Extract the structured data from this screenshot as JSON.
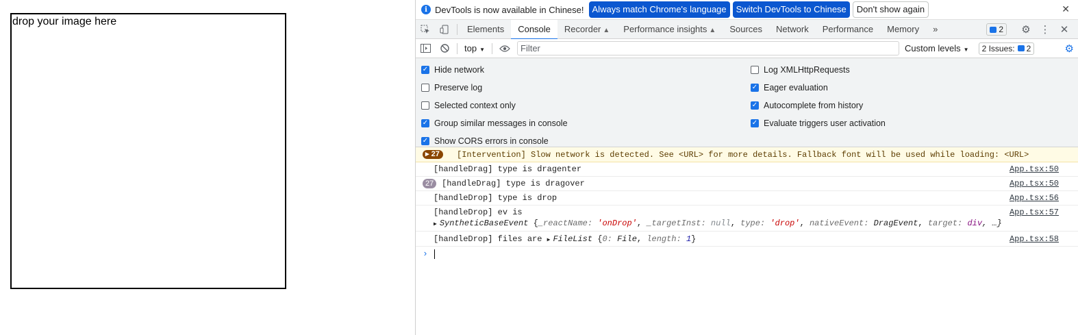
{
  "page": {
    "dropzone_text": "drop your image here"
  },
  "infobar": {
    "message": "DevTools is now available in Chinese!",
    "btn_match": "Always match Chrome's language",
    "btn_switch": "Switch DevTools to Chinese",
    "btn_dismiss": "Don't show again",
    "close": "✕"
  },
  "tabs": [
    "Elements",
    "Console",
    "Recorder",
    "Performance insights",
    "Sources",
    "Network",
    "Performance",
    "Memory"
  ],
  "tabbar": {
    "overflow": "»",
    "messages_count": "2"
  },
  "toolbar": {
    "context": "top",
    "filter_placeholder": "Filter",
    "levels": "Custom levels",
    "issues_label": "2 Issues:",
    "issues_count": "2"
  },
  "settings": {
    "left": [
      {
        "label": "Hide network",
        "checked": true
      },
      {
        "label": "Preserve log",
        "checked": false
      },
      {
        "label": "Selected context only",
        "checked": false
      },
      {
        "label": "Group similar messages in console",
        "checked": true
      },
      {
        "label": "Show CORS errors in console",
        "checked": true
      }
    ],
    "right": [
      {
        "label": "Log XMLHttpRequests",
        "checked": false
      },
      {
        "label": "Eager evaluation",
        "checked": true
      },
      {
        "label": "Autocomplete from history",
        "checked": true
      },
      {
        "label": "Evaluate triggers user activation",
        "checked": true
      }
    ]
  },
  "console": {
    "warning": {
      "count": "27",
      "text": "[Intervention] Slow network is detected. See <URL> for more details. Fallback font will be used while loading: <URL>"
    },
    "rows": [
      {
        "text": "[handleDrag] type is dragenter",
        "source": "App.tsx:50"
      },
      {
        "count": "27",
        "text": "[handleDrag] type is dragover",
        "source": "App.tsx:50"
      },
      {
        "text": "[handleDrop] type is drop",
        "source": "App.tsx:56"
      },
      {
        "text": "[handleDrop] ev is",
        "source": "App.tsx:57"
      },
      {
        "text": "[handleDrop] files are",
        "source": "App.tsx:58"
      }
    ],
    "event_obj": {
      "type_name": "SyntheticBaseEvent",
      "k1": "_reactName:",
      "v1": "'onDrop'",
      "k2": "_targetInst:",
      "v2": "null",
      "k3": "type:",
      "v3": "'drop'",
      "k4": "nativeEvent:",
      "v4": "DragEvent",
      "k5": "target:",
      "v5": "div",
      "tail": ", …}"
    },
    "file_obj": {
      "type_name": "FileList",
      "k1": "0:",
      "v1": "File",
      "k2": "length:",
      "v2": "1"
    },
    "prompt": "›"
  }
}
